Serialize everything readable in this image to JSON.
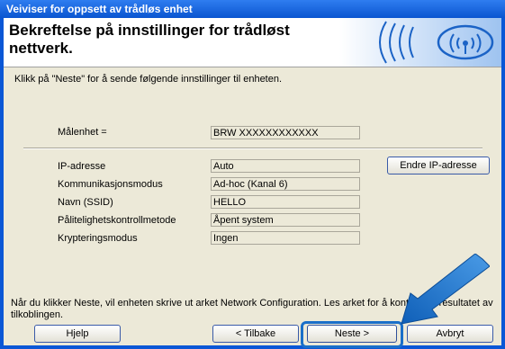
{
  "window": {
    "title": "Veiviser for oppsett av trådløs enhet"
  },
  "header": {
    "title": "Bekreftelse på innstillinger for trådløst nettverk."
  },
  "instruction": "Klikk på \"Neste\" for å sende følgende innstillinger til enheten.",
  "target": {
    "label": "Målenhet =",
    "value": "BRW XXXXXXXXXXXX"
  },
  "settings": [
    {
      "label": "IP-adresse",
      "value": "Auto"
    },
    {
      "label": "Kommunikasjonsmodus",
      "value": "Ad-hoc (Kanal 6)"
    },
    {
      "label": "Navn (SSID)",
      "value": "HELLO"
    },
    {
      "label": "Pålitelighetskontrollmetode",
      "value": "Åpent system"
    },
    {
      "label": "Krypteringsmodus",
      "value": "Ingen"
    }
  ],
  "buttons": {
    "change_ip": "Endre IP-adresse",
    "help": "Hjelp",
    "back": "< Tilbake",
    "next": "Neste >",
    "cancel": "Avbryt"
  },
  "footer_text": "Når du klikker Neste, vil enheten skrive ut arket Network Configuration. Les arket for å kontrollere resultatet av tilkoblingen.",
  "icons": {
    "wireless": "wireless-signal-icon",
    "pointer": "pointer-arrow-icon"
  },
  "colors": {
    "titlebar": "#0a55d0",
    "dialog_bg": "#ece9d8",
    "arrow": "#1a6fc9"
  }
}
